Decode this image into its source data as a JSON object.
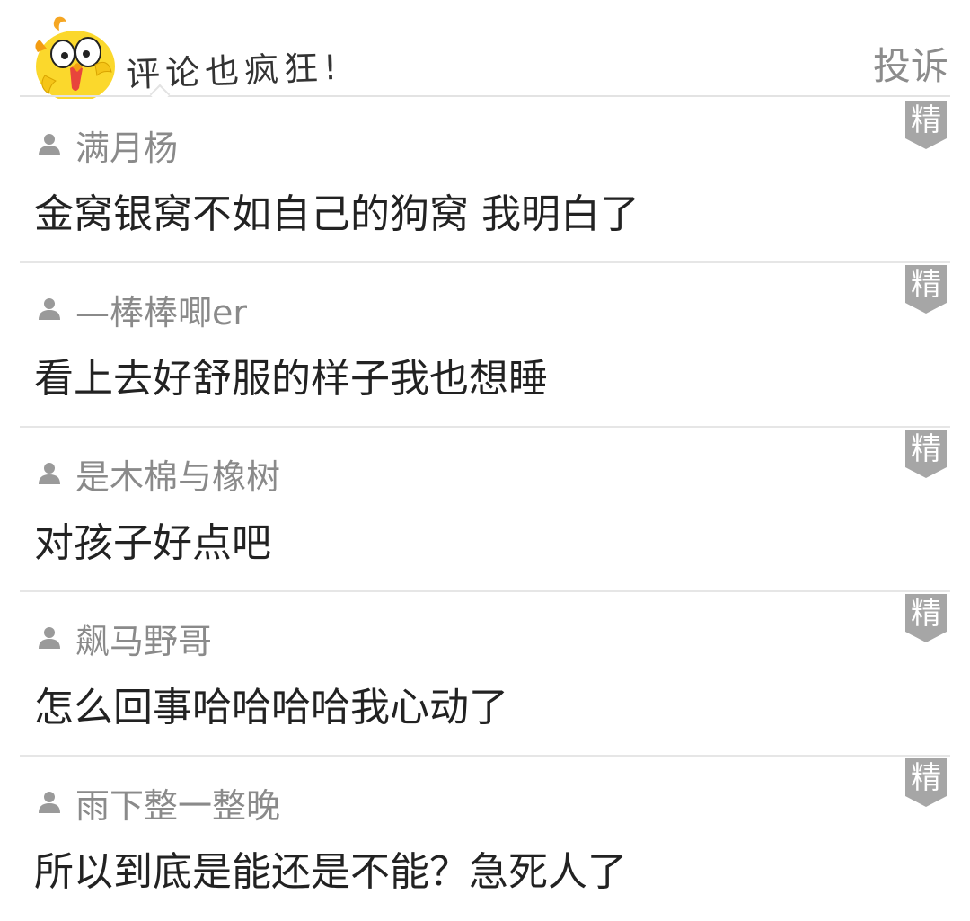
{
  "header": {
    "title": "评论也疯狂!",
    "report_label": "投诉",
    "mascot_icon": "yellow-chick-mascot"
  },
  "badge_label": "精",
  "colors": {
    "badge": "#a6a6a6",
    "username": "#8a8a8a",
    "comment_text": "#222222",
    "divider": "#e6e6e6",
    "mascot_yellow": "#fbd82c"
  },
  "comments": [
    {
      "username": "满月杨",
      "text": "金窝银窝不如自己的狗窝 我明白了"
    },
    {
      "username": "—棒棒唧er",
      "text": "看上去好舒服的样子我也想睡"
    },
    {
      "username": "是木棉与橡树",
      "text": "对孩子好点吧"
    },
    {
      "username": "飙马野哥",
      "text": "怎么回事哈哈哈哈我心动了"
    },
    {
      "username": "雨下整一整晚",
      "text": "所以到底是能还是不能？急死人了"
    }
  ]
}
